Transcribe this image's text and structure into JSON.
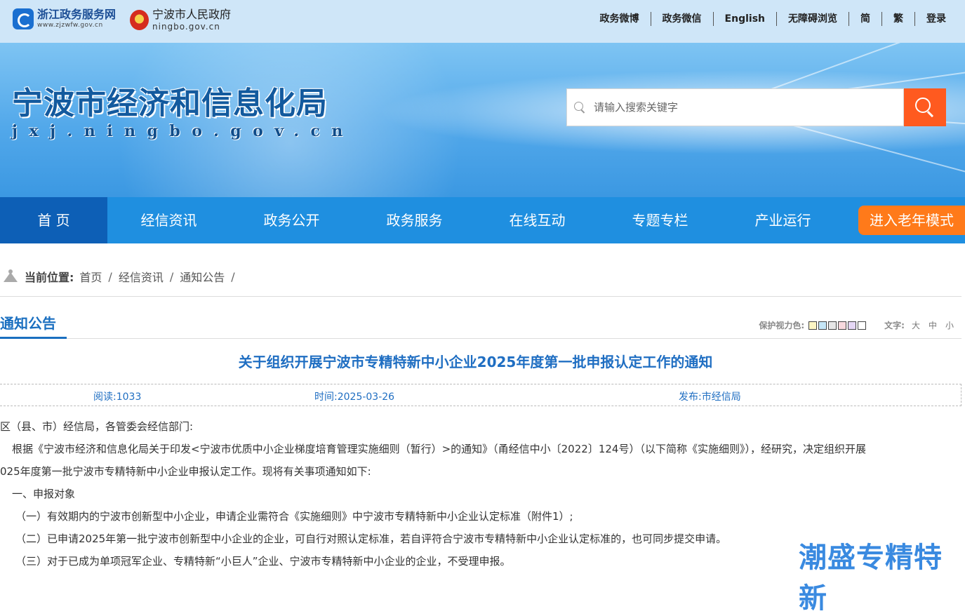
{
  "topbar": {
    "logo1_title": "浙江政务服务网",
    "logo1_sub": "www.zjzwfw.gov.cn",
    "logo2_title": "宁波市人民政府",
    "logo2_sub": "ningbo.gov.cn",
    "links": [
      "政务微博",
      "政务微信",
      "English",
      "无障碍浏览",
      "简",
      "繁",
      "登录"
    ]
  },
  "banner": {
    "title": "宁波市经济和信息化局",
    "domain": "jxj.ningbo.gov.cn",
    "search_placeholder": "请输入搜索关键字"
  },
  "nav": {
    "items": [
      "首 页",
      "经信资讯",
      "政务公开",
      "政务服务",
      "在线互动",
      "专题专栏",
      "产业运行"
    ],
    "elder_mode": "进入老年模式"
  },
  "breadcrumb": {
    "label": "当前位置:",
    "items": [
      "首页",
      "经信资讯",
      "通知公告"
    ]
  },
  "section": {
    "title": "通知公告",
    "eye_care_label": "保护视力色:",
    "eye_care_colors": [
      "#fdf6c4",
      "#c5e6f7",
      "#e6e6e6",
      "#f7d9de",
      "#e5d7f5",
      "#ffffff"
    ],
    "font_label": "文字:",
    "font_sizes": [
      "大",
      "中",
      "小"
    ]
  },
  "article": {
    "title": "关于组织开展宁波市专精特新中小企业2025年度第一批申报认定工作的通知",
    "reads": "阅读:1033",
    "date": "时间:2025-03-26",
    "publisher": "发布:市经信局",
    "paragraphs": [
      "区（县、市）经信局，各管委会经信部门:",
      "根据《宁波市经济和信息化局关于印发<宁波市优质中小企业梯度培育管理实施细则（暂行）>的通知》（甬经信中小〔2022〕124号）（以下简称《实施细则》），经研究，决定组织开展",
      "025年度第一批宁波市专精特新中小企业申报认定工作。现将有关事项通知如下:",
      "一、申报对象",
      "（一）有效期内的宁波市创新型中小企业，申请企业需符合《实施细则》中宁波市专精特新中小企业认定标准（附件1）;",
      "（二）已申请2025年第一批宁波市创新型中小企业的企业，可自行对照认定标准，若自评符合宁波市专精特新中小企业认定标准的，也可同步提交申请。",
      "（三）对于已成为单项冠军企业、专精特新“小巨人”企业、宁波市专精特新中小企业的企业，不受理申报。"
    ]
  },
  "watermark": "潮盛专精特新"
}
